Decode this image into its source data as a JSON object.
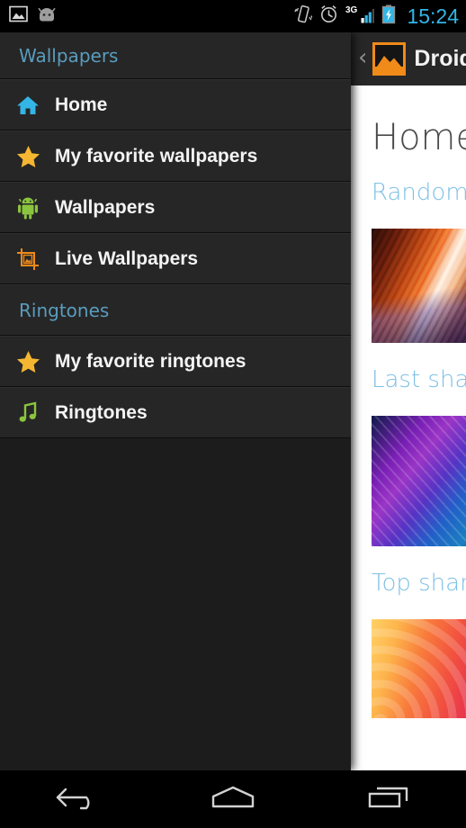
{
  "status_bar": {
    "icons": [
      "image-notification-icon",
      "android-head-icon",
      "vibrate-icon",
      "alarm-clock-icon",
      "signal-3g-icon",
      "battery-charging-icon"
    ],
    "network_label": "3G",
    "clock": "15:24",
    "clock_color": "#33b5e5"
  },
  "action_bar": {
    "back_glyph": "‹",
    "app_icon": "picture-frame-icon",
    "app_icon_color": "#f08a19",
    "title": "Droid Wallpapers"
  },
  "content": {
    "heading": "Home",
    "sections": [
      {
        "label": "Random",
        "thumbnail": "canyon-wallpaper-thumbnail"
      },
      {
        "label": "Last shared",
        "thumbnail": "purple-stripes-wallpaper-thumbnail"
      },
      {
        "label": "Top shared",
        "thumbnail": "warm-arcs-wallpaper-thumbnail"
      }
    ],
    "section_label_color": "#7ec0e4",
    "heading_color": "#4a4a4a",
    "background_color": "#ffffff"
  },
  "drawer": {
    "background_color": "#262626",
    "groups": [
      {
        "title": "Wallpapers",
        "items": [
          {
            "label": "Home",
            "icon": "home-icon",
            "icon_color": "#33b5e5"
          },
          {
            "label": "My favorite wallpapers",
            "icon": "star-icon",
            "icon_color": "#f5b731"
          },
          {
            "label": "Wallpapers",
            "icon": "android-robot-icon",
            "icon_color": "#8bc53f"
          },
          {
            "label": "Live Wallpapers",
            "icon": "crop-image-icon",
            "icon_color": "#f08a19"
          }
        ]
      },
      {
        "title": "Ringtones",
        "items": [
          {
            "label": "My favorite ringtones",
            "icon": "star-icon",
            "icon_color": "#f5b731"
          },
          {
            "label": "Ringtones",
            "icon": "music-note-icon",
            "icon_color": "#8bc53f"
          }
        ]
      }
    ],
    "section_title_color": "#5a9cbd"
  },
  "nav_bar": {
    "buttons": [
      {
        "name": "back-button",
        "icon": "back-arrow-icon"
      },
      {
        "name": "home-button",
        "icon": "home-pentagon-icon"
      },
      {
        "name": "recent-apps-button",
        "icon": "recent-apps-icon"
      }
    ]
  }
}
